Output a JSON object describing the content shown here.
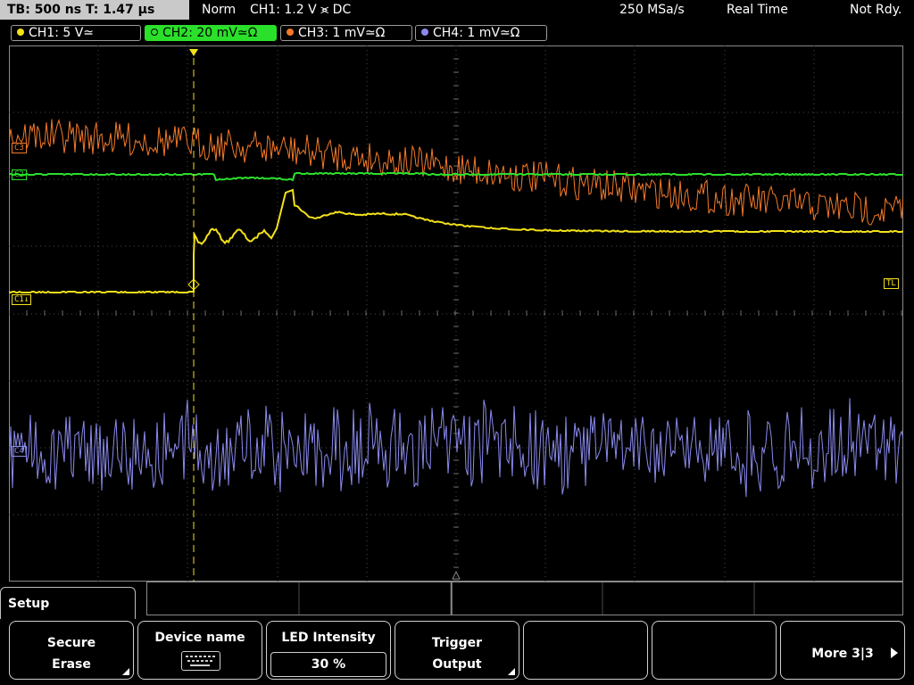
{
  "status_bar": {
    "timebase": "TB: 500 ns   T: 1.47 µs",
    "mode": "Norm",
    "trigger_info": "CH1: 1.2 V ⪤ DC",
    "sample_rate": "250 MSa/s",
    "acq_mode": "Real Time",
    "status": "Not Rdy."
  },
  "channels": [
    {
      "label": "CH1: 5 V≃",
      "color": "#f4e21a",
      "active": false
    },
    {
      "label": "CH2: 20 mV≃Ω",
      "color": "#2be02b",
      "active": true
    },
    {
      "label": "CH3: 1 mV≃Ω",
      "color": "#f47a2a",
      "active": false
    },
    {
      "label": "CH4: 1 mV≃Ω",
      "color": "#8a8aee",
      "active": false
    }
  ],
  "markers": {
    "c1": "C1↓",
    "c2": "C2",
    "c3": "C3",
    "c4": "C4",
    "tl": "TL",
    "trigger": "T"
  },
  "menu": {
    "title": "Setup",
    "keys": [
      {
        "line1": "Secure",
        "line2": "Erase"
      },
      {
        "line1": "Device name"
      },
      {
        "line1": "LED Intensity",
        "value": "30 %"
      },
      {
        "line1": "Trigger",
        "line2": "Output"
      },
      {
        "line1": ""
      },
      {
        "line1": ""
      },
      {
        "line1": "More 3|3"
      }
    ]
  },
  "colors": {
    "ch1": "#f4e21a",
    "ch2": "#2be02b",
    "ch3": "#f47a2a",
    "ch4": "#8a8aee",
    "grid": "#5a5a5a"
  }
}
